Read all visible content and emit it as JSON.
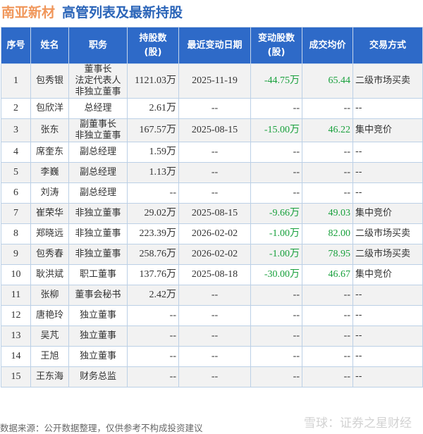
{
  "title": {
    "company": "南亚新材",
    "subtitle": "高管列表及最新持股"
  },
  "headers": [
    "序号",
    "姓名",
    "职务",
    "持股数\n(股)",
    "最近变动日期",
    "变动股数\n(股)",
    "成交均价",
    "交易方式"
  ],
  "rows": [
    {
      "no": "1",
      "name": "包秀银",
      "role": "董事长\n法定代表人\n非独立董事",
      "shares": "1121.03万",
      "date": "2025-11-19",
      "change": "-44.75万",
      "price": "65.44",
      "method": "二级市场买卖"
    },
    {
      "no": "2",
      "name": "包欣洋",
      "role": "总经理",
      "shares": "2.61万",
      "date": "--",
      "change": "--",
      "price": "--",
      "method": "--"
    },
    {
      "no": "3",
      "name": "张东",
      "role": "副董事长\n非独立董事",
      "shares": "167.57万",
      "date": "2025-08-15",
      "change": "-15.00万",
      "price": "46.22",
      "method": "集中竞价"
    },
    {
      "no": "4",
      "name": "席奎东",
      "role": "副总经理",
      "shares": "1.59万",
      "date": "--",
      "change": "--",
      "price": "--",
      "method": "--"
    },
    {
      "no": "5",
      "name": "李巍",
      "role": "副总经理",
      "shares": "1.13万",
      "date": "--",
      "change": "--",
      "price": "--",
      "method": "--"
    },
    {
      "no": "6",
      "name": "刘涛",
      "role": "副总经理",
      "shares": "--",
      "date": "--",
      "change": "--",
      "price": "--",
      "method": "--"
    },
    {
      "no": "7",
      "name": "崔荣华",
      "role": "非独立董事",
      "shares": "29.02万",
      "date": "2025-08-15",
      "change": "-9.66万",
      "price": "49.03",
      "method": "集中竞价"
    },
    {
      "no": "8",
      "name": "郑晓远",
      "role": "非独立董事",
      "shares": "223.39万",
      "date": "2026-02-02",
      "change": "-1.00万",
      "price": "82.00",
      "method": "二级市场买卖"
    },
    {
      "no": "9",
      "name": "包秀春",
      "role": "非独立董事",
      "shares": "258.76万",
      "date": "2026-02-02",
      "change": "-1.00万",
      "price": "78.95",
      "method": "二级市场买卖"
    },
    {
      "no": "10",
      "name": "耿洪斌",
      "role": "职工董事",
      "shares": "137.76万",
      "date": "2025-08-18",
      "change": "-30.00万",
      "price": "46.67",
      "method": "集中竞价"
    },
    {
      "no": "11",
      "name": "张柳",
      "role": "董事会秘书",
      "shares": "2.42万",
      "date": "--",
      "change": "--",
      "price": "--",
      "method": "--"
    },
    {
      "no": "12",
      "name": "唐艳玲",
      "role": "独立董事",
      "shares": "--",
      "date": "--",
      "change": "--",
      "price": "--",
      "method": "--"
    },
    {
      "no": "13",
      "name": "吴芃",
      "role": "独立董事",
      "shares": "--",
      "date": "--",
      "change": "--",
      "price": "--",
      "method": "--"
    },
    {
      "no": "14",
      "name": "王旭",
      "role": "独立董事",
      "shares": "--",
      "date": "--",
      "change": "--",
      "price": "--",
      "method": "--"
    },
    {
      "no": "15",
      "name": "王东海",
      "role": "财务总监",
      "shares": "--",
      "date": "--",
      "change": "--",
      "price": "--",
      "method": "--"
    }
  ],
  "footer": "数据来源：公开数据整理，仅供参考不构成投资建议",
  "brand": "雪球：证券之星财经",
  "colors": {
    "header_bg": "#2e6ac8",
    "title_company": "#f0965a",
    "title_sub": "#2a64b8",
    "change_negative": "#18a03c"
  }
}
